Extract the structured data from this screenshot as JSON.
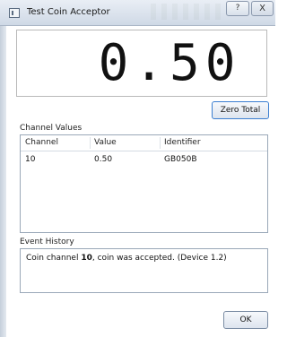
{
  "window": {
    "title": "Test Coin Acceptor",
    "help_glyph": "?",
    "close_glyph": "X"
  },
  "display": {
    "value": "0.50"
  },
  "buttons": {
    "zero_total": "Zero Total",
    "ok": "OK"
  },
  "channel_values": {
    "label": "Channel Values",
    "columns": [
      "Channel",
      "Value",
      "Identifier"
    ],
    "rows": [
      {
        "channel": "10",
        "value": "0.50",
        "identifier": "GB050B"
      }
    ]
  },
  "event_history": {
    "label": "Event History",
    "entries": [
      {
        "prefix": "Coin channel ",
        "channel": "10",
        "suffix": ", coin was accepted. (Device 1.2)"
      }
    ]
  }
}
